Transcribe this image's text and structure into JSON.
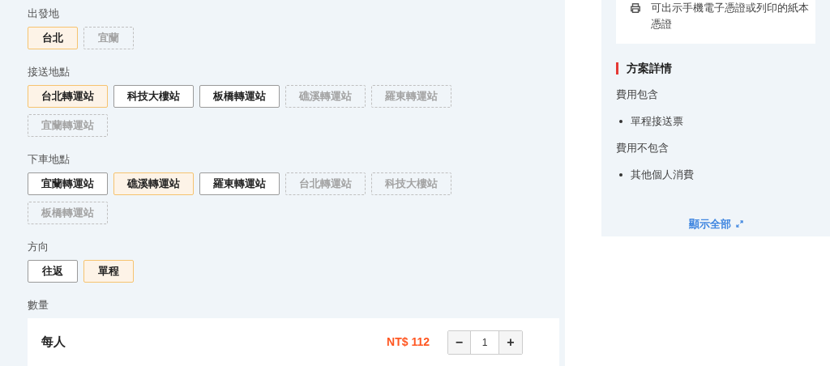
{
  "option_groups": [
    {
      "label": "出發地",
      "options": [
        {
          "label": "台北",
          "selected": true,
          "disabled": false
        },
        {
          "label": "宜蘭",
          "selected": false,
          "disabled": true
        }
      ]
    },
    {
      "label": "接送地點",
      "options": [
        {
          "label": "台北轉運站",
          "selected": true,
          "disabled": false
        },
        {
          "label": "科技大樓站",
          "selected": false,
          "disabled": false
        },
        {
          "label": "板橋轉運站",
          "selected": false,
          "disabled": false
        },
        {
          "label": "礁溪轉運站",
          "selected": false,
          "disabled": true
        },
        {
          "label": "羅東轉運站",
          "selected": false,
          "disabled": true
        },
        {
          "label": "宜蘭轉運站",
          "selected": false,
          "disabled": true
        }
      ]
    },
    {
      "label": "下車地點",
      "options": [
        {
          "label": "宜蘭轉運站",
          "selected": false,
          "disabled": false
        },
        {
          "label": "礁溪轉運站",
          "selected": true,
          "disabled": false
        },
        {
          "label": "羅東轉運站",
          "selected": false,
          "disabled": false
        },
        {
          "label": "台北轉運站",
          "selected": false,
          "disabled": true
        },
        {
          "label": "科技大樓站",
          "selected": false,
          "disabled": true
        },
        {
          "label": "板橋轉運站",
          "selected": false,
          "disabled": true
        }
      ]
    },
    {
      "label": "方向",
      "options": [
        {
          "label": "往返",
          "selected": false,
          "disabled": false
        },
        {
          "label": "單程",
          "selected": true,
          "disabled": false
        }
      ]
    }
  ],
  "quantity": {
    "label": "數量",
    "unit": "每人",
    "price": "NT$ 112",
    "minus": "−",
    "value": "1",
    "plus": "+"
  },
  "sidebar": {
    "voucher_note": "可出示手機電子憑證或列印的紙本憑證",
    "details_title": "方案詳情",
    "sections": [
      {
        "heading": "費用包含",
        "items": [
          "單程接送票"
        ]
      },
      {
        "heading": "費用不包含",
        "items": [
          "其他個人消費"
        ]
      }
    ],
    "show_all": "顯示全部"
  }
}
